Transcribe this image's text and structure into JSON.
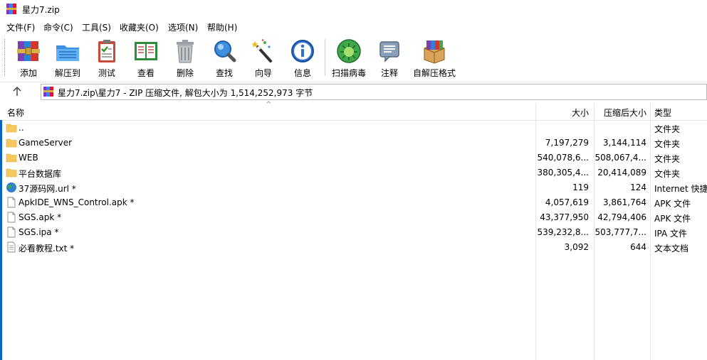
{
  "window": {
    "title": "星力7.zip"
  },
  "menu": [
    {
      "label": "文件(F)"
    },
    {
      "label": "命令(C)"
    },
    {
      "label": "工具(S)"
    },
    {
      "label": "收藏夹(O)"
    },
    {
      "label": "选项(N)"
    },
    {
      "label": "帮助(H)"
    }
  ],
  "toolbar": {
    "buttons": [
      {
        "label": "添加",
        "icon": "archive-books-icon"
      },
      {
        "label": "解压到",
        "icon": "extract-folder-icon"
      },
      {
        "label": "测试",
        "icon": "test-clipboard-icon"
      },
      {
        "label": "查看",
        "icon": "view-book-icon"
      },
      {
        "label": "删除",
        "icon": "trash-can-icon"
      },
      {
        "label": "查找",
        "icon": "magnifier-icon"
      },
      {
        "label": "向导",
        "icon": "magic-wand-icon"
      },
      {
        "label": "信息",
        "icon": "info-icon"
      },
      {
        "label": "扫描病毒",
        "icon": "virus-scan-icon"
      },
      {
        "label": "注释",
        "icon": "comment-icon"
      },
      {
        "label": "自解压格式",
        "icon": "sfx-box-icon"
      }
    ]
  },
  "address": {
    "path": "星力7.zip\\星力7 - ZIP 压缩文件, 解包大小为 1,514,252,973 字节"
  },
  "list": {
    "columns": {
      "name": "名称",
      "size": "大小",
      "packed": "压缩后大小",
      "type": "类型"
    },
    "rows": [
      {
        "name": "..",
        "size": "",
        "packed": "",
        "type": "文件夹",
        "icon": "folder-icon"
      },
      {
        "name": "GameServer",
        "size": "7,197,279",
        "packed": "3,144,114",
        "type": "文件夹",
        "icon": "folder-icon"
      },
      {
        "name": "WEB",
        "size": "540,078,6...",
        "packed": "508,067,4...",
        "type": "文件夹",
        "icon": "folder-icon"
      },
      {
        "name": "平台数据库",
        "size": "380,305,4...",
        "packed": "20,414,089",
        "type": "文件夹",
        "icon": "folder-icon"
      },
      {
        "name": "37源码网.url *",
        "size": "119",
        "packed": "124",
        "type": "Internet 快捷",
        "icon": "globe-icon"
      },
      {
        "name": "ApkIDE_WNS_Control.apk *",
        "size": "4,057,619",
        "packed": "3,861,764",
        "type": "APK 文件",
        "icon": "file-icon"
      },
      {
        "name": "SGS.apk *",
        "size": "43,377,950",
        "packed": "42,794,406",
        "type": "APK 文件",
        "icon": "file-icon"
      },
      {
        "name": "SGS.ipa *",
        "size": "539,232,8...",
        "packed": "503,777,7...",
        "type": "IPA 文件",
        "icon": "file-icon"
      },
      {
        "name": "必看教程.txt *",
        "size": "3,092",
        "packed": "644",
        "type": "文本文档",
        "icon": "text-file-icon"
      }
    ]
  },
  "colors": {
    "folder": "#f6c85f",
    "accent_edge": "#0a64c8",
    "header_divider": "#e5e5e5"
  }
}
